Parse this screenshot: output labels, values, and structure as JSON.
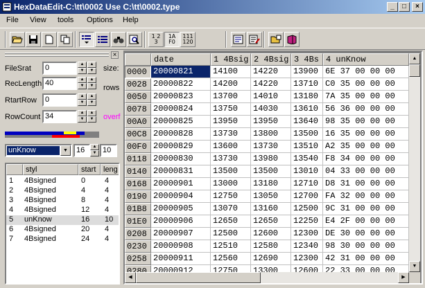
{
  "window": {
    "title": "HexDataEdit-C:\\tt\\0002 Use C:\\tt\\0002.type",
    "minimize": "_",
    "maximize": "□",
    "close": "×"
  },
  "menu": [
    "File",
    "View",
    "tools",
    "Options",
    "Help"
  ],
  "toolbar": {
    "icons": [
      "open-folder-icon",
      "save-icon",
      "new-icon",
      "copy-icon",
      "rows-dropdown-icon",
      "grid-icon",
      "find-icon",
      "inspect-icon",
      "decimal-icon",
      "hex-icon",
      "binary-icon",
      "edit-doc-icon",
      "edit-list-icon",
      "folder-open-icon",
      "book-icon"
    ],
    "dec_label": "1 2 3",
    "hex_label": "1A F0",
    "bin_label": "111 120"
  },
  "left_panel": {
    "file_start_label": "FileSrat",
    "file_start_value": "0",
    "size_label": "size:",
    "rec_length_label": "RecLength",
    "rec_length_value": "40",
    "rows_label": "rows",
    "start_row_label": "RtartRow",
    "start_row_value": "0",
    "row_count_label": "RowCount",
    "row_count_value": "34",
    "overflow_label": "overf",
    "type_select": "unKnow",
    "type_size": "16",
    "type_extra": "10",
    "colors": {
      "blue": "#0000c0",
      "red": "#ff0000",
      "yellow": "#ffff00",
      "gray": "#808080",
      "overflow": "#ff00ff",
      "selection": "#0a246a"
    },
    "field_list": {
      "headers": [
        "",
        "styl",
        "start",
        "leng"
      ],
      "rows": [
        {
          "n": "1",
          "styl": "4Bsigned",
          "start": "0",
          "leng": "4"
        },
        {
          "n": "2",
          "styl": "4Bsigned",
          "start": "4",
          "leng": "4"
        },
        {
          "n": "3",
          "styl": "4Bsigned",
          "start": "8",
          "leng": "4"
        },
        {
          "n": "4",
          "styl": "4Bsigned",
          "start": "12",
          "leng": "4"
        },
        {
          "n": "5",
          "styl": "unKnow",
          "start": "16",
          "leng": "10"
        },
        {
          "n": "6",
          "styl": "4Bsigned",
          "start": "20",
          "leng": "4"
        },
        {
          "n": "7",
          "styl": "4Bsigned",
          "start": "24",
          "leng": "4"
        }
      ],
      "selected_index": 4
    }
  },
  "grid": {
    "headers": [
      "date",
      "1 4Bsig",
      "2 4Bsig",
      "3 4Bs",
      "4 unKnow"
    ],
    "rows": [
      {
        "offset": "0000",
        "date": "20000821",
        "c1": "14100",
        "c2": "14220",
        "c3": "13900",
        "c4": "6E 37 00 00 00"
      },
      {
        "offset": "0028",
        "date": "20000822",
        "c1": "14200",
        "c2": "14220",
        "c3": "13710",
        "c4": "C0 35 00 00 00"
      },
      {
        "offset": "0050",
        "date": "20000823",
        "c1": "13700",
        "c2": "14010",
        "c3": "13180",
        "c4": "7A 35 00 00 00"
      },
      {
        "offset": "0078",
        "date": "20000824",
        "c1": "13750",
        "c2": "14030",
        "c3": "13610",
        "c4": "56 36 00 00 00"
      },
      {
        "offset": "00A0",
        "date": "20000825",
        "c1": "13950",
        "c2": "13950",
        "c3": "13640",
        "c4": "98 35 00 00 00"
      },
      {
        "offset": "00C8",
        "date": "20000828",
        "c1": "13730",
        "c2": "13800",
        "c3": "13500",
        "c4": "16 35 00 00 00"
      },
      {
        "offset": "00F0",
        "date": "20000829",
        "c1": "13600",
        "c2": "13730",
        "c3": "13510",
        "c4": "A2 35 00 00 00"
      },
      {
        "offset": "0118",
        "date": "20000830",
        "c1": "13730",
        "c2": "13980",
        "c3": "13540",
        "c4": "F8 34 00 00 00"
      },
      {
        "offset": "0140",
        "date": "20000831",
        "c1": "13500",
        "c2": "13500",
        "c3": "13010",
        "c4": "04 33 00 00 00"
      },
      {
        "offset": "0168",
        "date": "20000901",
        "c1": "13000",
        "c2": "13180",
        "c3": "12710",
        "c4": "D8 31 00 00 00"
      },
      {
        "offset": "0190",
        "date": "20000904",
        "c1": "12750",
        "c2": "13050",
        "c3": "12700",
        "c4": "FA 32 00 00 00"
      },
      {
        "offset": "01B8",
        "date": "20000905",
        "c1": "13070",
        "c2": "13160",
        "c3": "12500",
        "c4": "9C 31 00 00 00"
      },
      {
        "offset": "01E0",
        "date": "20000906",
        "c1": "12650",
        "c2": "12650",
        "c3": "12250",
        "c4": "E4 2F 00 00 00"
      },
      {
        "offset": "0208",
        "date": "20000907",
        "c1": "12500",
        "c2": "12600",
        "c3": "12300",
        "c4": "DE 30 00 00 00"
      },
      {
        "offset": "0230",
        "date": "20000908",
        "c1": "12510",
        "c2": "12580",
        "c3": "12340",
        "c4": "98 30 00 00 00"
      },
      {
        "offset": "0258",
        "date": "20000911",
        "c1": "12560",
        "c2": "12690",
        "c3": "12300",
        "c4": "42 31 00 00 00"
      },
      {
        "offset": "0280",
        "date": "20000912",
        "c1": "12750",
        "c2": "13300",
        "c3": "12600",
        "c4": "22 33 00 00 00"
      }
    ]
  }
}
